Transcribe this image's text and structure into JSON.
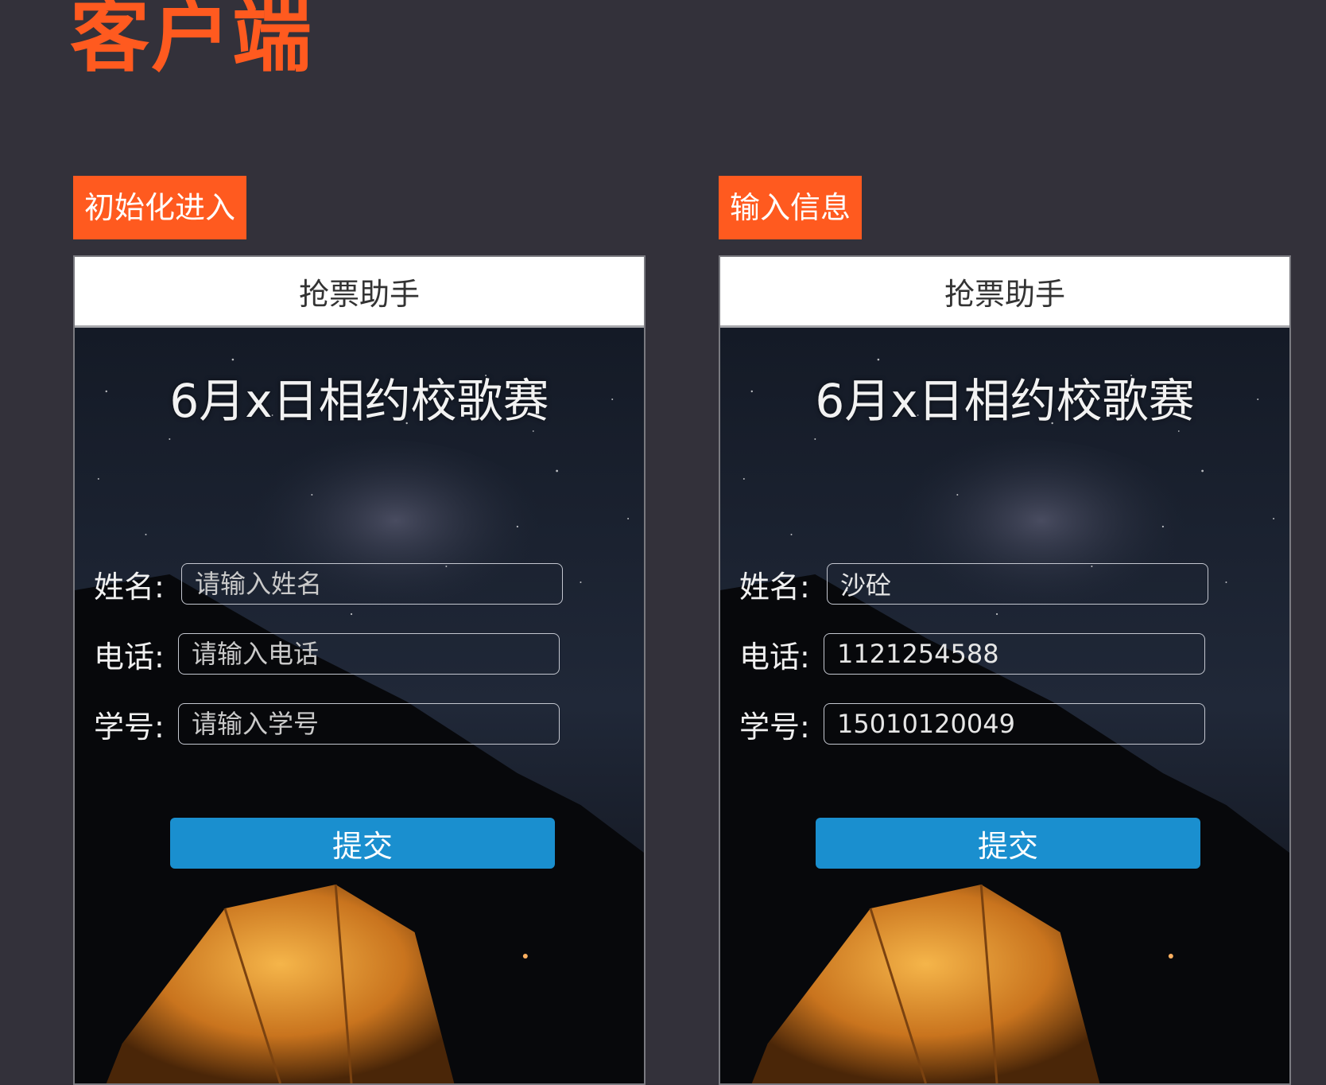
{
  "colors": {
    "page_bg": "#33313a",
    "accent": "#ff5a1f",
    "button": "#1a8fcf"
  },
  "page_heading": "客户端",
  "screens": [
    {
      "step_label": "初始化进入",
      "app_title": "抢票助手",
      "event_title": "6月x日相约校歌赛",
      "fields": [
        {
          "label": "姓名:",
          "value": "",
          "placeholder": "请输入姓名"
        },
        {
          "label": "电话:",
          "value": "",
          "placeholder": "请输入电话"
        },
        {
          "label": "学号:",
          "value": "",
          "placeholder": "请输入学号"
        }
      ],
      "submit_label": "提交"
    },
    {
      "step_label": "输入信息",
      "app_title": "抢票助手",
      "event_title": "6月x日相约校歌赛",
      "fields": [
        {
          "label": "姓名:",
          "value": "沙砼",
          "placeholder": "请输入姓名"
        },
        {
          "label": "电话:",
          "value": "1121254588",
          "placeholder": "请输入电话"
        },
        {
          "label": "学号:",
          "value": "15010120049",
          "placeholder": "请输入学号"
        }
      ],
      "submit_label": "提交"
    }
  ]
}
